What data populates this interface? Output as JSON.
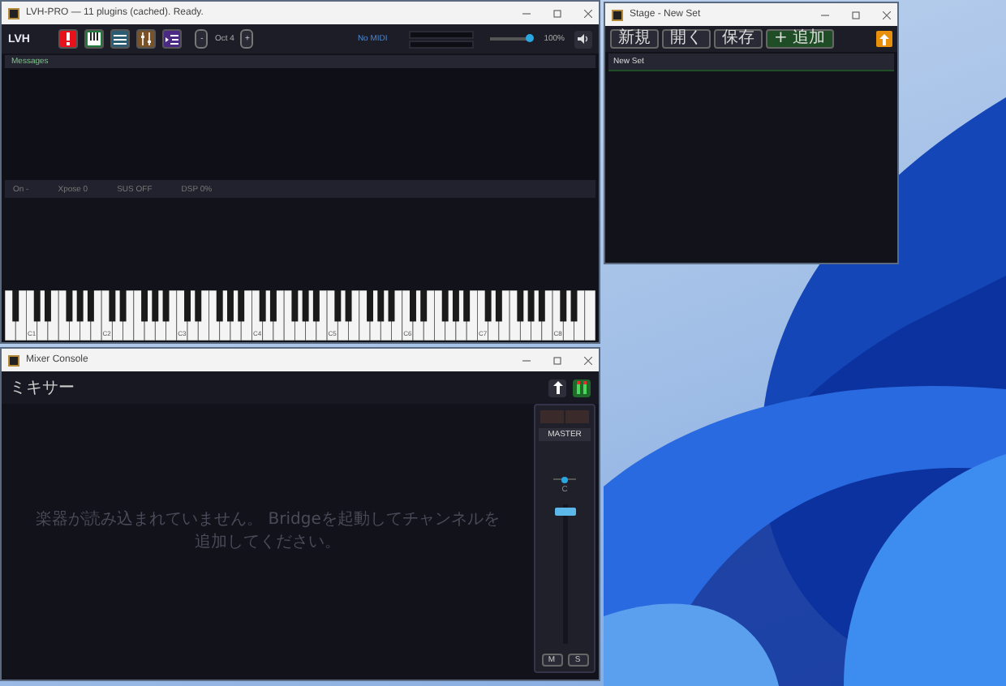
{
  "main_window": {
    "title": "LVH-PRO — 11 plugins (cached). Ready.",
    "toolbar": {
      "brand": "LVH",
      "tool_buttons": [
        {
          "kind": "alert",
          "color": "#e8101a"
        },
        {
          "kind": "piano",
          "color": "#1f7a3a"
        },
        {
          "kind": "list",
          "color": "#2a5d74"
        },
        {
          "kind": "sliders",
          "color": "#7a5228"
        },
        {
          "kind": "indent",
          "color": "#4b2a86"
        }
      ],
      "octave_down": "-",
      "octave_label": "Oct 4",
      "octave_up": "+",
      "midi_status": "No MIDI",
      "volume": {
        "level": 0.97,
        "reading": "100%"
      }
    },
    "messages_header": "Messages",
    "status_items": [
      "On -",
      "Xpose 0",
      "SUS OFF",
      "DSP 0%"
    ],
    "piano": {
      "octave_labels": [
        "C1",
        "C2",
        "C3",
        "C4",
        "C5",
        "C6",
        "C7",
        "C8"
      ]
    }
  },
  "stage_window": {
    "title": "Stage - New Set",
    "buttons": [
      {
        "label": "新規",
        "kind": "plain"
      },
      {
        "label": "開く",
        "kind": "plain"
      },
      {
        "label": "保存",
        "kind": "plain"
      },
      {
        "label": "+ 追加",
        "kind": "primary"
      }
    ],
    "set_name": "New Set"
  },
  "mixer_window": {
    "title": "Mixer Console",
    "heading": "ミキサー",
    "empty_message": "楽器が読み込まれていません。 Bridgeを起動してチャンネルを追加してください。",
    "master": {
      "label": "MASTER",
      "pan": {
        "level": 0.5
      },
      "pan_label": "C",
      "fader": {
        "level": 0.95
      },
      "mute": "M",
      "solo": "S"
    }
  }
}
